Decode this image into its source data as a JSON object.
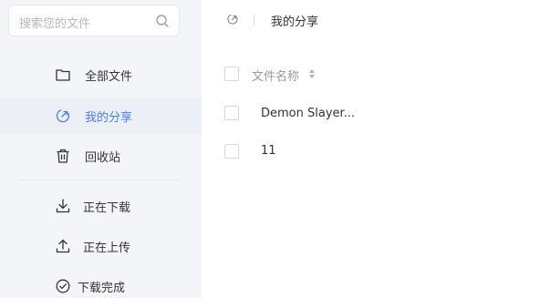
{
  "search": {
    "placeholder": "搜索您的文件"
  },
  "sidebar": {
    "items": [
      {
        "label": "全部文件",
        "icon": "folder-icon",
        "active": false
      },
      {
        "label": "我的分享",
        "icon": "share-icon",
        "active": true
      },
      {
        "label": "回收站",
        "icon": "trash-icon",
        "active": false
      },
      {
        "label": "正在下载",
        "icon": "download-icon",
        "active": false
      },
      {
        "label": "正在上传",
        "icon": "upload-icon",
        "active": false
      },
      {
        "label": "下载完成",
        "icon": "check-circle-icon",
        "active": false
      }
    ]
  },
  "breadcrumb": {
    "icon": "share-icon",
    "current": "我的分享"
  },
  "table": {
    "columns": [
      {
        "label": "文件名称",
        "sortable": true
      }
    ],
    "rows": [
      {
        "name": "Demon Slayer..."
      },
      {
        "name": "11"
      }
    ]
  },
  "colors": {
    "accent": "#4a7cf6",
    "sidebar_bg": "#f3f5f8",
    "active_bg": "#eceff6"
  }
}
